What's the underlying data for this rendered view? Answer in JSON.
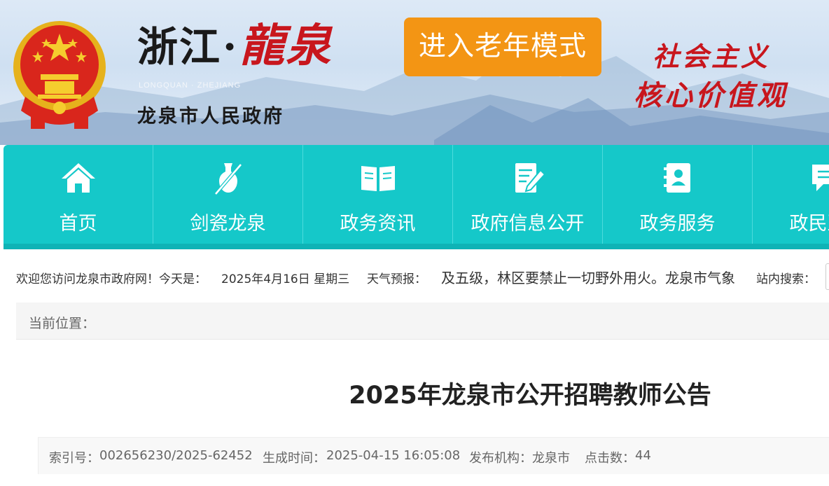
{
  "banner": {
    "site_name_zhejiang": "浙江",
    "site_name_dot": "·",
    "site_name_longquan": "龍泉",
    "site_pinyin": "LONGQUAN · ZHEJIANG",
    "site_subtitle": "龙泉市人民政府",
    "elder_mode_button": "进入老年模式",
    "slogan_line1": "社会主义",
    "slogan_line2": "核心价值观"
  },
  "nav": {
    "items": [
      {
        "label": "首页",
        "icon": "home-icon"
      },
      {
        "label": "剑瓷龙泉",
        "icon": "sword-vase-icon"
      },
      {
        "label": "政务资讯",
        "icon": "open-book-icon"
      },
      {
        "label": "政府信息公开",
        "icon": "document-pen-icon"
      },
      {
        "label": "政务服务",
        "icon": "contact-book-icon"
      },
      {
        "label": "政民互动",
        "icon": "chat-bubble-icon"
      }
    ]
  },
  "infobar": {
    "welcome": "欢迎您访问龙泉市政府网！今天是：",
    "date": "2025年4月16日 星期三",
    "weather_label": "天气预报：",
    "weather_ticker": "及五级，林区要禁止一切野外用火。龙泉市气象",
    "search_label": "站内搜索："
  },
  "breadcrumb": {
    "label": "当前位置："
  },
  "article": {
    "title": "2025年龙泉市公开招聘教师公告",
    "index_label": "索引号：",
    "index_value": "002656230/2025-62452",
    "created_label": "生成时间：",
    "created_value": "2025-04-15 16:05:08",
    "publisher_label": "发布机构：",
    "publisher_value": "龙泉市",
    "clicks_label": "点击数：",
    "clicks_value": "44"
  },
  "colors": {
    "nav_bg": "#15c8c9",
    "elder_button": "#f39514",
    "brand_red": "#c8161d"
  }
}
